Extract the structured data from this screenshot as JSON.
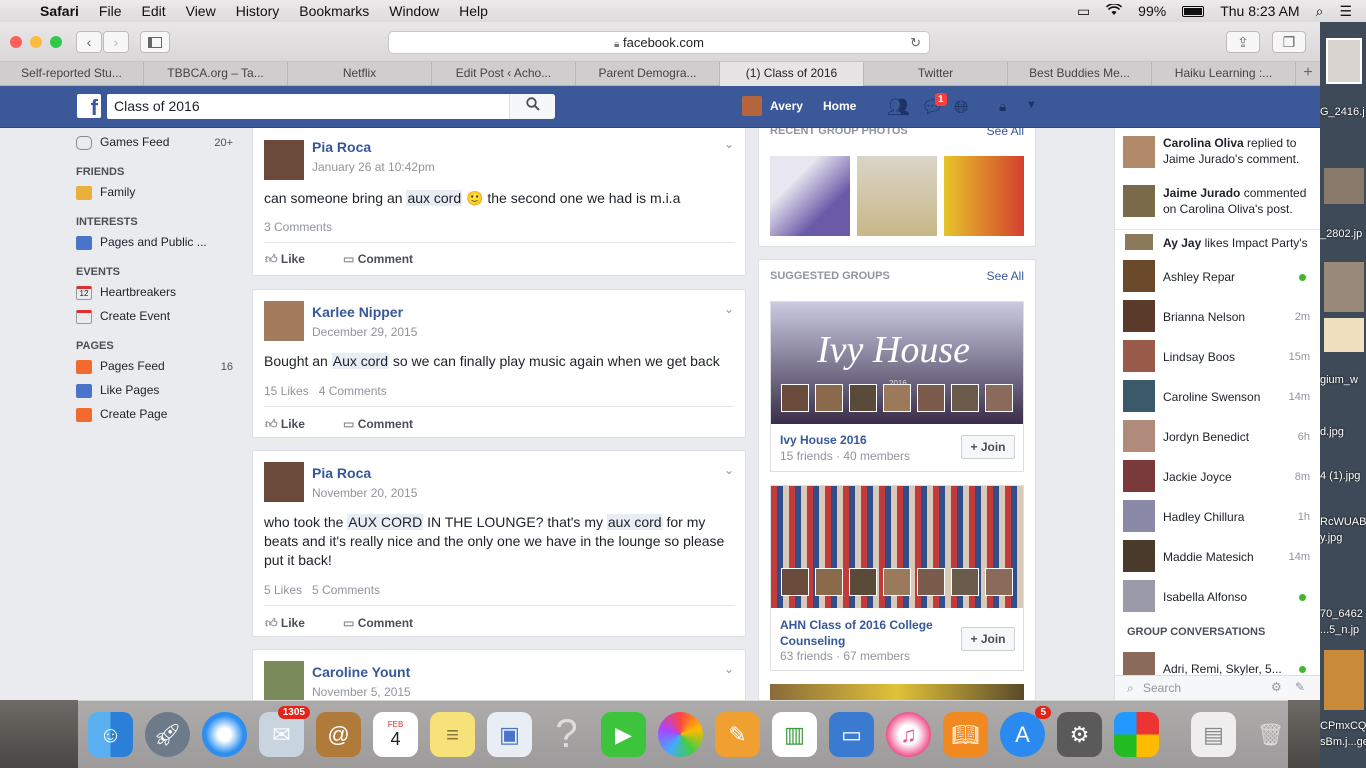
{
  "menubar": {
    "app": "Safari",
    "items": [
      "File",
      "Edit",
      "View",
      "History",
      "Bookmarks",
      "Window",
      "Help"
    ],
    "battery": "99%",
    "clock": "Thu 8:23 AM"
  },
  "browser": {
    "url": "facebook.com",
    "tabs": [
      "Self-reported Stu...",
      "TBBCA.org – Ta...",
      "Netflix",
      "Edit Post ‹ Acho...",
      "Parent Demogra...",
      "(1) Class of 2016",
      "Twitter",
      "Best Buddies Me...",
      "Haiku Learning :..."
    ],
    "active_tab": 5
  },
  "header": {
    "search_value": "Class of 2016",
    "user": "Avery",
    "home": "Home",
    "notif_count": "1"
  },
  "left_nav": {
    "games_feed": "Games Feed",
    "games_count": "20+",
    "friends_head": "FRIENDS",
    "family": "Family",
    "interests_head": "INTERESTS",
    "pages_public": "Pages and Public ...",
    "events_head": "EVENTS",
    "heartbreakers": "Heartbreakers",
    "cal_num": "12",
    "create_event": "Create Event",
    "pages_head": "PAGES",
    "pages_feed": "Pages Feed",
    "pages_feed_count": "16",
    "like_pages": "Like Pages",
    "create_page": "Create Page"
  },
  "posts": [
    {
      "author": "Pia Roca",
      "date": "January 26 at 10:42pm",
      "text_before": "can someone bring an ",
      "highlight": "aux cord",
      "text_after": " 🙂 the second one we had is m.i.a",
      "stats": "3 Comments",
      "like": "Like",
      "comment": "Comment"
    },
    {
      "author": "Karlee Nipper",
      "date": "December 29, 2015",
      "text_before": "Bought an ",
      "highlight": "Aux cord",
      "text_after": " so we can finally play music again when we get back",
      "stats": "15 Likes   4 Comments",
      "like": "Like",
      "comment": "Comment"
    },
    {
      "author": "Pia Roca",
      "date": "November 20, 2015",
      "text_1": "who took the ",
      "highlight_1": "AUX CORD",
      "text_2": " IN THE LOUNGE? that's my ",
      "highlight_2": "aux cord",
      "text_3": " for my beats and it's really nice and the only one we have in the lounge so please put it back!",
      "stats": "5 Likes   5 Comments",
      "like": "Like",
      "comment": "Comment"
    },
    {
      "author": "Caroline Yount",
      "date": "November 5, 2015"
    }
  ],
  "right_col": {
    "recent_photos": "RECENT GROUP PHOTOS",
    "see_all": "See All",
    "suggested": "SUGGESTED GROUPS",
    "groups": [
      {
        "banner": "Ivy House",
        "banner_year": "2016",
        "name": "Ivy House 2016",
        "meta": "15 friends · 40 members",
        "join": "+ Join"
      },
      {
        "name": "AHN Class of 2016 College Counseling",
        "meta": "63 friends · 67 members",
        "join": "+ Join"
      }
    ]
  },
  "chat": {
    "notifs": [
      {
        "who": "Carolina Oliva",
        "rest": " replied to Jaime Jurado's comment."
      },
      {
        "who": "Jaime Jurado",
        "rest": " commented on Carolina Oliva's post."
      },
      {
        "who": "Ay Jay",
        "rest": " likes Impact Party's"
      }
    ],
    "contacts": [
      {
        "name": "Ashley Repar",
        "status": "online"
      },
      {
        "name": "Brianna Nelson",
        "status": "2m"
      },
      {
        "name": "Lindsay Boos",
        "status": "15m"
      },
      {
        "name": "Caroline Swenson",
        "status": "14m"
      },
      {
        "name": "Jordyn Benedict",
        "status": "6h"
      },
      {
        "name": "Jackie Joyce",
        "status": "8m"
      },
      {
        "name": "Hadley Chillura",
        "status": "1h"
      },
      {
        "name": "Maddie Matesich",
        "status": "14m"
      },
      {
        "name": "Isabella Alfonso",
        "status": "online"
      }
    ],
    "group_conv": "GROUP CONVERSATIONS",
    "group_item": "Adri, Remi, Skyler, 5...",
    "search_placeholder": "Search"
  },
  "desktop_files": [
    "G_2416.j",
    "_2802.jp",
    "gium_w",
    "d.jpg",
    "4 (1).jpg",
    "RcWUAB",
    "y.jpg",
    "70_6462",
    "...5_n.jp",
    "CPmxCQZWsA",
    "sBm.j...ge.jp"
  ],
  "dock": {
    "mail_badge": "1305",
    "appstore_badge": "5",
    "cal_month": "FEB",
    "cal_day": "4"
  }
}
